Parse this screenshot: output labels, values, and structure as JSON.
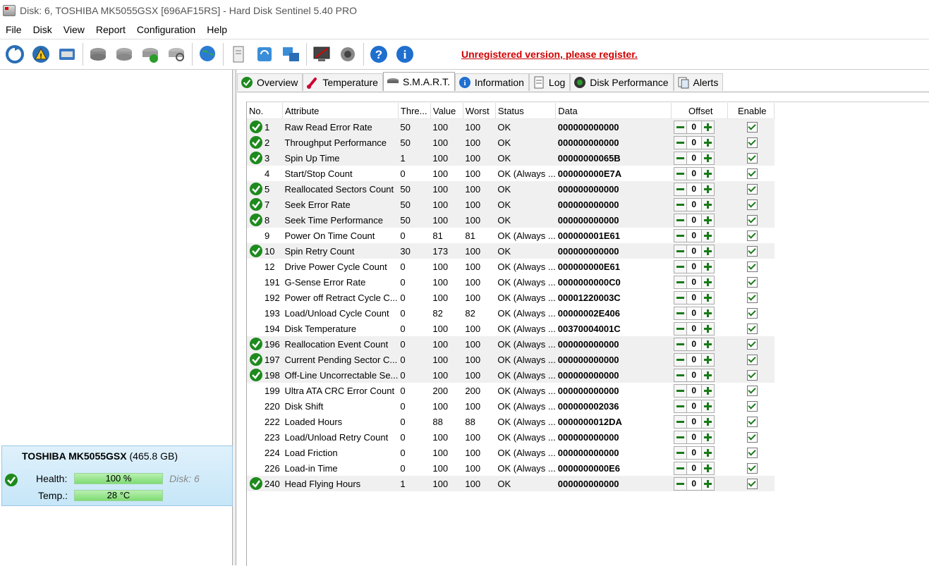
{
  "window": {
    "title": "Disk: 6, TOSHIBA MK5055GSX [696AF15RS]  -  Hard Disk Sentinel 5.40 PRO"
  },
  "menu": [
    "File",
    "Disk",
    "View",
    "Report",
    "Configuration",
    "Help"
  ],
  "toolbar": {
    "icons": [
      "refresh-icon",
      "alert-icon",
      "disk-icon",
      "hdd-icon",
      "hdd-tools-icon",
      "hdd-check-icon",
      "hdd-search-icon",
      "globe-icon",
      "report-icon",
      "sync-icon",
      "network-icon",
      "monitor-icon",
      "speaker-icon",
      "help-icon",
      "info-icon"
    ],
    "register_link": "Unregistered version, please register."
  },
  "disk_card": {
    "name": "TOSHIBA MK5055GSX",
    "size": "(465.8 GB)",
    "health_label": "Health:",
    "health_value": "100 %",
    "temp_label": "Temp.:",
    "temp_value": "28 °C",
    "disk_label": "Disk: 6",
    "health_color": "#7fdc74"
  },
  "tabs": [
    {
      "label": "Overview",
      "icon": "check-icon"
    },
    {
      "label": "Temperature",
      "icon": "thermometer-icon"
    },
    {
      "label": "S.M.A.R.T.",
      "icon": "hdd-icon",
      "active": true
    },
    {
      "label": "Information",
      "icon": "info-icon"
    },
    {
      "label": "Log",
      "icon": "log-icon"
    },
    {
      "label": "Disk Performance",
      "icon": "gauge-icon"
    },
    {
      "label": "Alerts",
      "icon": "alerts-icon"
    }
  ],
  "smart": {
    "headers": [
      "No.",
      "Attribute",
      "Thre...",
      "Value",
      "Worst",
      "Status",
      "Data",
      "Offset",
      "Enable"
    ],
    "rows": [
      {
        "no": "1",
        "attr": "Raw Read Error Rate",
        "thr": "50",
        "val": "100",
        "worst": "100",
        "status": "OK",
        "data": "000000000000",
        "offset": "0",
        "check": true
      },
      {
        "no": "2",
        "attr": "Throughput Performance",
        "thr": "50",
        "val": "100",
        "worst": "100",
        "status": "OK",
        "data": "000000000000",
        "offset": "0",
        "check": true
      },
      {
        "no": "3",
        "attr": "Spin Up Time",
        "thr": "1",
        "val": "100",
        "worst": "100",
        "status": "OK",
        "data": "00000000065B",
        "offset": "0",
        "check": true
      },
      {
        "no": "4",
        "attr": "Start/Stop Count",
        "thr": "0",
        "val": "100",
        "worst": "100",
        "status": "OK (Always ...",
        "data": "000000000E7A",
        "offset": "0",
        "check": false
      },
      {
        "no": "5",
        "attr": "Reallocated Sectors Count",
        "thr": "50",
        "val": "100",
        "worst": "100",
        "status": "OK",
        "data": "000000000000",
        "offset": "0",
        "check": true
      },
      {
        "no": "7",
        "attr": "Seek Error Rate",
        "thr": "50",
        "val": "100",
        "worst": "100",
        "status": "OK",
        "data": "000000000000",
        "offset": "0",
        "check": true
      },
      {
        "no": "8",
        "attr": "Seek Time Performance",
        "thr": "50",
        "val": "100",
        "worst": "100",
        "status": "OK",
        "data": "000000000000",
        "offset": "0",
        "check": true
      },
      {
        "no": "9",
        "attr": "Power On Time Count",
        "thr": "0",
        "val": "81",
        "worst": "81",
        "status": "OK (Always ...",
        "data": "000000001E61",
        "offset": "0",
        "check": false
      },
      {
        "no": "10",
        "attr": "Spin Retry Count",
        "thr": "30",
        "val": "173",
        "worst": "100",
        "status": "OK",
        "data": "000000000000",
        "offset": "0",
        "check": true
      },
      {
        "no": "12",
        "attr": "Drive Power Cycle Count",
        "thr": "0",
        "val": "100",
        "worst": "100",
        "status": "OK (Always ...",
        "data": "000000000E61",
        "offset": "0",
        "check": false
      },
      {
        "no": "191",
        "attr": "G-Sense Error Rate",
        "thr": "0",
        "val": "100",
        "worst": "100",
        "status": "OK (Always ...",
        "data": "0000000000C0",
        "offset": "0",
        "check": false
      },
      {
        "no": "192",
        "attr": "Power off Retract Cycle C...",
        "thr": "0",
        "val": "100",
        "worst": "100",
        "status": "OK (Always ...",
        "data": "00001220003C",
        "offset": "0",
        "check": false
      },
      {
        "no": "193",
        "attr": "Load/Unload Cycle Count",
        "thr": "0",
        "val": "82",
        "worst": "82",
        "status": "OK (Always ...",
        "data": "00000002E406",
        "offset": "0",
        "check": false
      },
      {
        "no": "194",
        "attr": "Disk Temperature",
        "thr": "0",
        "val": "100",
        "worst": "100",
        "status": "OK (Always ...",
        "data": "00370004001C",
        "offset": "0",
        "check": false
      },
      {
        "no": "196",
        "attr": "Reallocation Event Count",
        "thr": "0",
        "val": "100",
        "worst": "100",
        "status": "OK (Always ...",
        "data": "000000000000",
        "offset": "0",
        "check": true
      },
      {
        "no": "197",
        "attr": "Current Pending Sector C...",
        "thr": "0",
        "val": "100",
        "worst": "100",
        "status": "OK (Always ...",
        "data": "000000000000",
        "offset": "0",
        "check": true
      },
      {
        "no": "198",
        "attr": "Off-Line Uncorrectable Se...",
        "thr": "0",
        "val": "100",
        "worst": "100",
        "status": "OK (Always ...",
        "data": "000000000000",
        "offset": "0",
        "check": true
      },
      {
        "no": "199",
        "attr": "Ultra ATA CRC Error Count",
        "thr": "0",
        "val": "200",
        "worst": "200",
        "status": "OK (Always ...",
        "data": "000000000000",
        "offset": "0",
        "check": false
      },
      {
        "no": "220",
        "attr": "Disk Shift",
        "thr": "0",
        "val": "100",
        "worst": "100",
        "status": "OK (Always ...",
        "data": "000000002036",
        "offset": "0",
        "check": false
      },
      {
        "no": "222",
        "attr": "Loaded Hours",
        "thr": "0",
        "val": "88",
        "worst": "88",
        "status": "OK (Always ...",
        "data": "0000000012DA",
        "offset": "0",
        "check": false
      },
      {
        "no": "223",
        "attr": "Load/Unload Retry Count",
        "thr": "0",
        "val": "100",
        "worst": "100",
        "status": "OK (Always ...",
        "data": "000000000000",
        "offset": "0",
        "check": false
      },
      {
        "no": "224",
        "attr": "Load Friction",
        "thr": "0",
        "val": "100",
        "worst": "100",
        "status": "OK (Always ...",
        "data": "000000000000",
        "offset": "0",
        "check": false
      },
      {
        "no": "226",
        "attr": "Load-in Time",
        "thr": "0",
        "val": "100",
        "worst": "100",
        "status": "OK (Always ...",
        "data": "0000000000E6",
        "offset": "0",
        "check": false
      },
      {
        "no": "240",
        "attr": "Head Flying Hours",
        "thr": "1",
        "val": "100",
        "worst": "100",
        "status": "OK",
        "data": "000000000000",
        "offset": "0",
        "check": true
      }
    ]
  }
}
